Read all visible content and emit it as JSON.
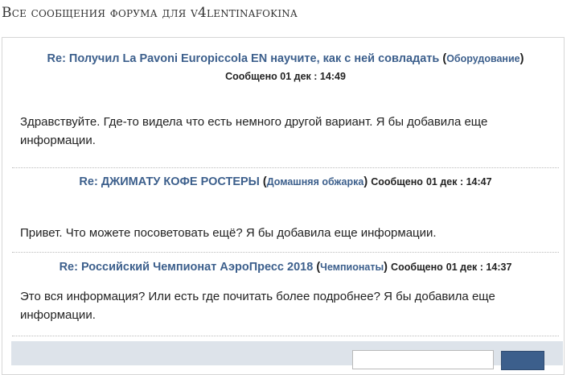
{
  "page": {
    "heading": "Все сообщения форума для v4lentinafokina"
  },
  "posts": [
    {
      "title": "Re: Получил La Pavoni Europiccola EN научите, как с ней совладать",
      "forum": "Оборудование",
      "posted_label": "Сообщено",
      "date": "01 дек : 14:49",
      "body": "Здравствуйте. Где-то видела что есть немного другой вариант. Я бы добавила еще информации."
    },
    {
      "title": "Re: ДЖИМАТУ КОФЕ РОСТЕРЫ",
      "forum": "Домашняя обжарка",
      "posted_label": "Сообщено",
      "date": "01 дек : 14:47",
      "body": "Привет. Что можете посоветовать ещё? Я бы добавила еще информации."
    },
    {
      "title": "Re: Российский Чемпионат АэроПресс 2018",
      "forum": "Чемпионаты",
      "posted_label": "Сообщено",
      "date": "01 дек : 14:37",
      "body": "Это вся информация? Или есть где почитать более подробнее? Я бы добавила еще информации."
    }
  ],
  "colors": {
    "link": "#3c5f8c",
    "footer_bg": "#dde3ea"
  }
}
